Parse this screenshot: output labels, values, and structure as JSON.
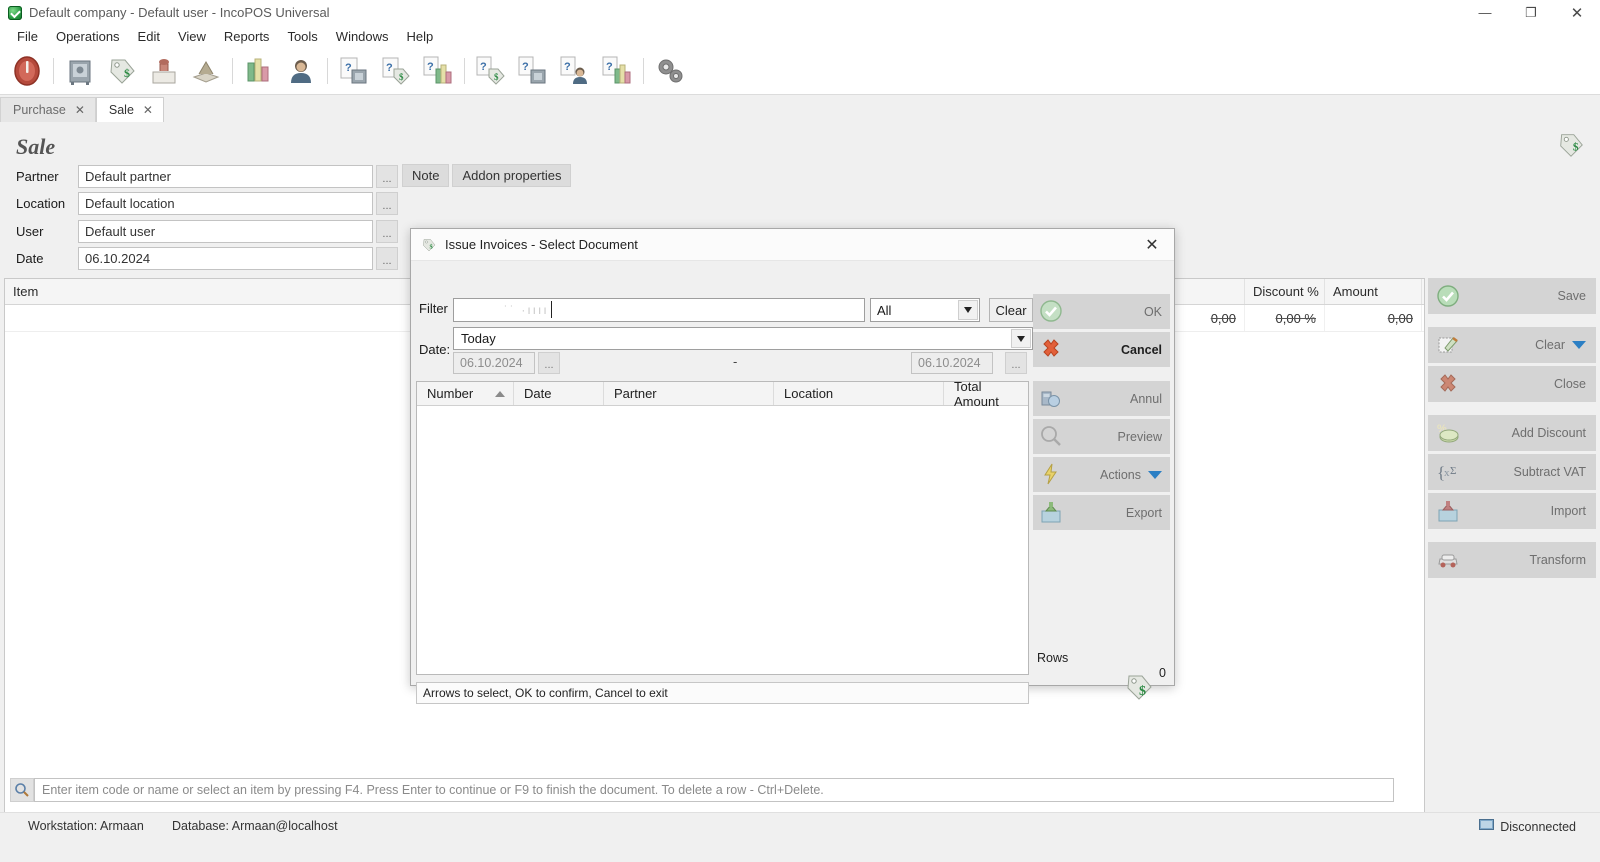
{
  "window": {
    "title": "Default company - Default user - IncoPOS Universal",
    "app_icon": "incopos-green-shield-icon",
    "minimize": "—",
    "maximize": "❐",
    "close": "✕"
  },
  "menubar": {
    "items": [
      "File",
      "Operations",
      "Edit",
      "View",
      "Reports",
      "Tools",
      "Windows",
      "Help"
    ]
  },
  "toolbar": {
    "buttons": [
      {
        "name": "power-exit-icon"
      },
      {
        "name": "purchase-safe-icon"
      },
      {
        "name": "sale-pricetag-icon"
      },
      {
        "name": "production-stamp-icon"
      },
      {
        "name": "transfer-book-icon"
      },
      {
        "name": "reports-chart-icon"
      },
      {
        "name": "partners-person-icon"
      },
      {
        "name": "request-safe-icon"
      },
      {
        "name": "offer-pricetag-icon"
      },
      {
        "name": "order-chart-icon"
      },
      {
        "name": "proforma-pricetag-icon"
      },
      {
        "name": "advance-safe-icon"
      },
      {
        "name": "consignment-person-icon"
      },
      {
        "name": "document-chart-icon"
      },
      {
        "name": "settings-gears-icon"
      }
    ]
  },
  "tabs": [
    {
      "label": "Purchase",
      "active": false,
      "close": "✕"
    },
    {
      "label": "Sale",
      "active": true,
      "close": "✕"
    }
  ],
  "document": {
    "title": "Sale",
    "fields": [
      {
        "label": "Partner",
        "value": "Default partner",
        "browse": "..."
      },
      {
        "label": "Location",
        "value": "Default location",
        "browse": "..."
      },
      {
        "label": "User",
        "value": "Default user",
        "browse": "..."
      },
      {
        "label": "Date",
        "value": "06.10.2024",
        "browse": "..."
      }
    ],
    "note_buttons": [
      "Note",
      "Addon properties"
    ],
    "corner_icon": "sale-pricetag-icon"
  },
  "grid": {
    "columns": [
      "Item",
      "",
      "",
      "Discount %",
      "Amount"
    ],
    "rows": [
      {
        "item": "",
        "qty": "0,00",
        "discount": "0,00 %",
        "amount": "0,00"
      }
    ]
  },
  "action_panel": {
    "buttons": [
      {
        "label": "Save",
        "icon": "green-check-icon",
        "group": 0
      },
      {
        "label": "Clear",
        "icon": "clear-pencil-icon",
        "group": 1,
        "caret": true
      },
      {
        "label": "Close",
        "icon": "red-x-icon",
        "group": 1
      },
      {
        "label": "Add Discount",
        "icon": "percent-money-icon",
        "group": 2
      },
      {
        "label": "Subtract VAT",
        "icon": "sigma-brackets-icon",
        "group": 2
      },
      {
        "label": "Import",
        "icon": "import-box-icon",
        "group": 2
      },
      {
        "label": "Transform",
        "icon": "transform-car-icon",
        "group": 3
      }
    ]
  },
  "entry_bar": {
    "icon": "search-magnifier-icon",
    "placeholder": "Enter item code or name or select an item by pressing F4. Press Enter to continue or F9 to finish the document. To delete a row - Ctrl+Delete."
  },
  "statusbar": {
    "workstation": "Workstation: Armaan",
    "database": "Database: Armaan@localhost",
    "connection": "Disconnected",
    "connection_icon": "disconnected-monitor-icon"
  },
  "dialog": {
    "title": "Issue Invoices - Select Document",
    "title_icon": "invoice-pricetag-icon",
    "close": "✕",
    "filter": {
      "label": "Filter",
      "value": "",
      "ghost_text": "˙˙ ·ıııı",
      "type_label": "All",
      "type_options": [
        "All"
      ],
      "clear_label": "Clear",
      "dropdown_arrow": "▼"
    },
    "date": {
      "label": "Date:",
      "period": "Today",
      "period_options": [
        "Today"
      ],
      "from": "06.10.2024",
      "to": "06.10.2024",
      "separator": "-",
      "browse": "...",
      "dropdown_arrow": "▼"
    },
    "grid": {
      "columns": [
        "Number",
        "Date",
        "Partner",
        "Location",
        "Total Amount"
      ],
      "sort_column": "Number",
      "sort_direction": "asc",
      "rows": []
    },
    "hint": "Arrows to select, OK to confirm, Cancel to exit",
    "rows_label": "Rows",
    "rows_count": "0",
    "logo_icon": "invoice-pricetag-icon",
    "buttons": [
      {
        "label": "OK",
        "icon": "green-check-icon",
        "enabled": false,
        "group": 0
      },
      {
        "label": "Cancel",
        "icon": "red-x-icon",
        "enabled": true,
        "group": 0
      },
      {
        "label": "Annul",
        "icon": "annul-coins-icon",
        "enabled": false,
        "group": 1
      },
      {
        "label": "Preview",
        "icon": "magnifier-icon",
        "enabled": false,
        "group": 1
      },
      {
        "label": "Actions",
        "icon": "lightning-icon",
        "enabled": false,
        "group": 1,
        "caret": true
      },
      {
        "label": "Export",
        "icon": "export-box-icon",
        "enabled": false,
        "group": 1
      }
    ]
  }
}
